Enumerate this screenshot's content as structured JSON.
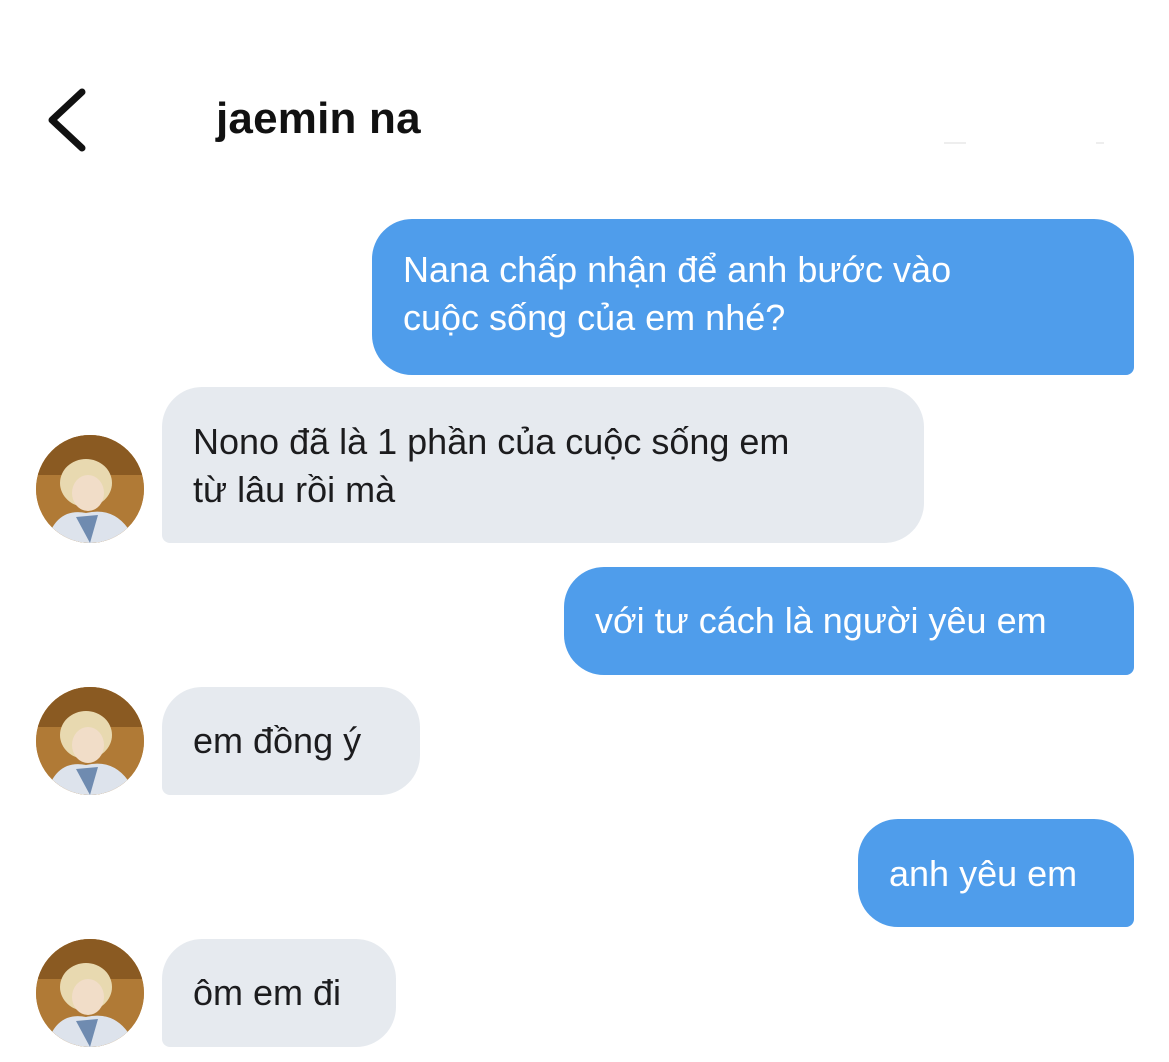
{
  "header": {
    "back_icon": "chevron-left-icon",
    "contact_name": "jaemin na"
  },
  "messages": [
    {
      "direction": "sent",
      "lines": [
        "Nana chấp nhận để anh bước vào",
        "cuộc sống của em nhé?"
      ]
    },
    {
      "direction": "received",
      "lines": [
        "Nono đã là 1 phần của cuộc sống em",
        "từ lâu rồi mà"
      ]
    },
    {
      "direction": "sent",
      "lines": [
        "với tư cách là người yêu em"
      ]
    },
    {
      "direction": "received",
      "lines": [
        "em đồng ý"
      ]
    },
    {
      "direction": "sent",
      "lines": [
        "anh yêu em"
      ]
    },
    {
      "direction": "received",
      "lines": [
        "ôm em đi"
      ]
    }
  ],
  "colors": {
    "sent_bubble": "#4f9deb",
    "received_bubble": "#e6eaef",
    "sent_text": "#ffffff",
    "received_text": "#1c1c1e"
  }
}
